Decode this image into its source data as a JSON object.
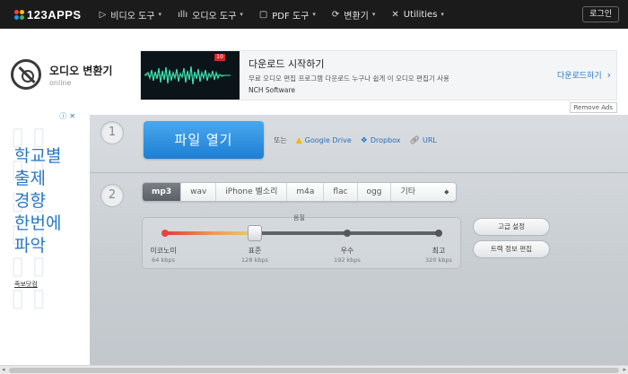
{
  "nav": {
    "logo": "123APPS",
    "items": [
      {
        "label": "비디오 도구",
        "icon": "play-icon"
      },
      {
        "label": "오디오 도구",
        "icon": "audio-wave-icon"
      },
      {
        "label": "PDF 도구",
        "icon": "pdf-icon"
      },
      {
        "label": "변환기",
        "icon": "convert-icon"
      },
      {
        "label": "Utilities",
        "icon": "tools-icon"
      }
    ],
    "login": "로그인"
  },
  "app": {
    "title": "오디오 변환기",
    "subtitle": "online"
  },
  "top_ad": {
    "heading": "다운로드 시작하기",
    "description": "무료 오디오 편집 프로그램 다운로드 누구나 쉽게 이 오디오 편집기 사용",
    "sponsor": "NCH Software",
    "cta": "다운로드하기",
    "badge": "10",
    "remove": "Remove Ads"
  },
  "left_ad": {
    "lines": [
      "학교별",
      "출제",
      "경향",
      "한번에",
      "파악"
    ],
    "footer": "족보닷컴"
  },
  "step1": {
    "number": "1",
    "open_label": "파일 열기",
    "or": "또는",
    "sources": [
      {
        "label": "Google Drive",
        "icon": "google-drive-icon"
      },
      {
        "label": "Dropbox",
        "icon": "dropbox-icon"
      },
      {
        "label": "URL",
        "icon": "link-icon"
      }
    ]
  },
  "step2": {
    "number": "2",
    "formats": [
      "mp3",
      "wav",
      "iPhone 벨소리",
      "m4a",
      "flac",
      "ogg",
      "기타"
    ],
    "selected_format": "mp3",
    "quality_title": "음질",
    "quality_levels": [
      {
        "name": "이코노미",
        "kbps": "64 kbps"
      },
      {
        "name": "표준",
        "kbps": "128 kbps"
      },
      {
        "name": "우수",
        "kbps": "192 kbps"
      },
      {
        "name": "최고",
        "kbps": "320 kbps"
      }
    ],
    "selected_quality": "표준",
    "advanced_settings": "고급 설정",
    "track_info": "트랙 정보 편집"
  },
  "colors": {
    "accent": "#1d7fd4",
    "topbar": "#1b1b1b",
    "link": "#2a6fb8"
  }
}
